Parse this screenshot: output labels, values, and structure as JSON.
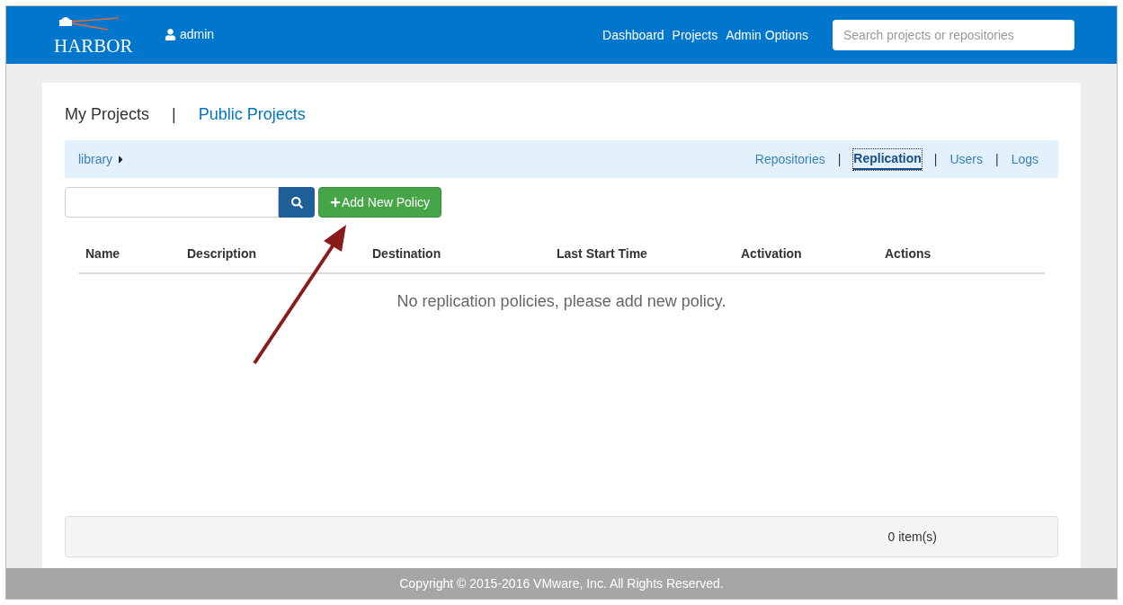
{
  "header": {
    "logo": "HARBOR",
    "user": "admin",
    "nav": [
      "Dashboard",
      "Projects",
      "Admin Options"
    ],
    "search": {
      "placeholder": "Search projects or repositories"
    }
  },
  "project_tabs": [
    {
      "label": "My Projects",
      "selected": true
    },
    {
      "label": "Public Projects",
      "selected": false
    }
  ],
  "separator": "|",
  "breadcrumb": "library",
  "sub_tabs": [
    {
      "label": "Repositories",
      "selected": false
    },
    {
      "label": "Replication",
      "selected": true
    },
    {
      "label": "Users",
      "selected": false
    },
    {
      "label": "Logs",
      "selected": false
    }
  ],
  "toolbar": {
    "add_button": "Add New Policy"
  },
  "table": {
    "columns": [
      "Name",
      "Description",
      "Destination",
      "Last Start Time",
      "Activation",
      "Actions"
    ],
    "empty_message": "No replication policies, please add new policy."
  },
  "pagination": {
    "count": "0 item(s)"
  },
  "footer": "Copyright © 2015-2016 VMware, Inc. All Rights Reserved."
}
